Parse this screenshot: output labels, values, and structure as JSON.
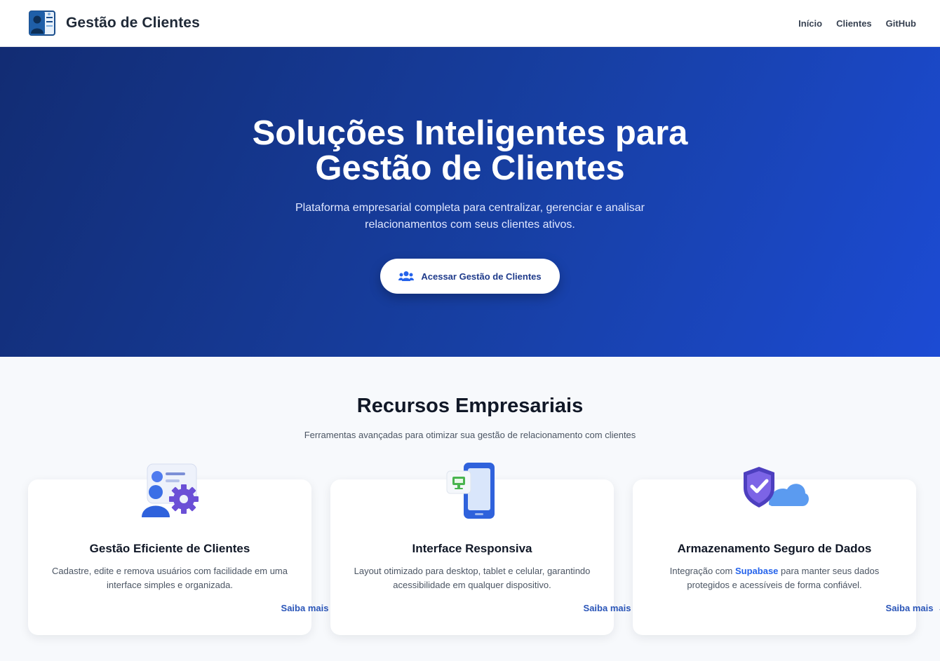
{
  "nav": {
    "brand": "Gestão de Clientes",
    "links": [
      "Início",
      "Clientes",
      "GitHub"
    ]
  },
  "hero": {
    "title": "Soluções Inteligentes para Gestão de Clientes",
    "description": "Plataforma empresarial completa para centralizar, gerenciar e analisar relacionamentos com seus clientes ativos.",
    "cta_label": "Acessar Gestão de Clientes",
    "cta_icon": "users-icon"
  },
  "features": {
    "title": "Recursos Empresariais",
    "subtitle": "Ferramentas avançadas para otimizar sua gestão de relacionamento com clientes",
    "cards": [
      {
        "icon": "user-settings-icon",
        "title": "Gestão Eficiente de Clientes",
        "description": "Cadastre, edite e remova usuários com facilidade em uma interface simples e organizada.",
        "link": "Saiba mais"
      },
      {
        "icon": "responsive-device-icon",
        "title": "Interface Responsiva",
        "description": "Layout otimizado para desktop, tablet e celular, garantindo acessibilidade em qualquer dispositivo.",
        "link": "Saiba mais"
      },
      {
        "icon": "secure-cloud-icon",
        "title": "Armazenamento Seguro de Dados",
        "description_before": "Integração com ",
        "description_highlight": "Supabase",
        "description_after": " para manter seus dados protegidos e acessíveis de forma confiável.",
        "link": "Saiba mais"
      }
    ]
  },
  "colors": {
    "primary": "#1e3a8a",
    "link": "#2a55b8",
    "hero_start": "#122c73",
    "hero_end": "#1c4bd4"
  }
}
